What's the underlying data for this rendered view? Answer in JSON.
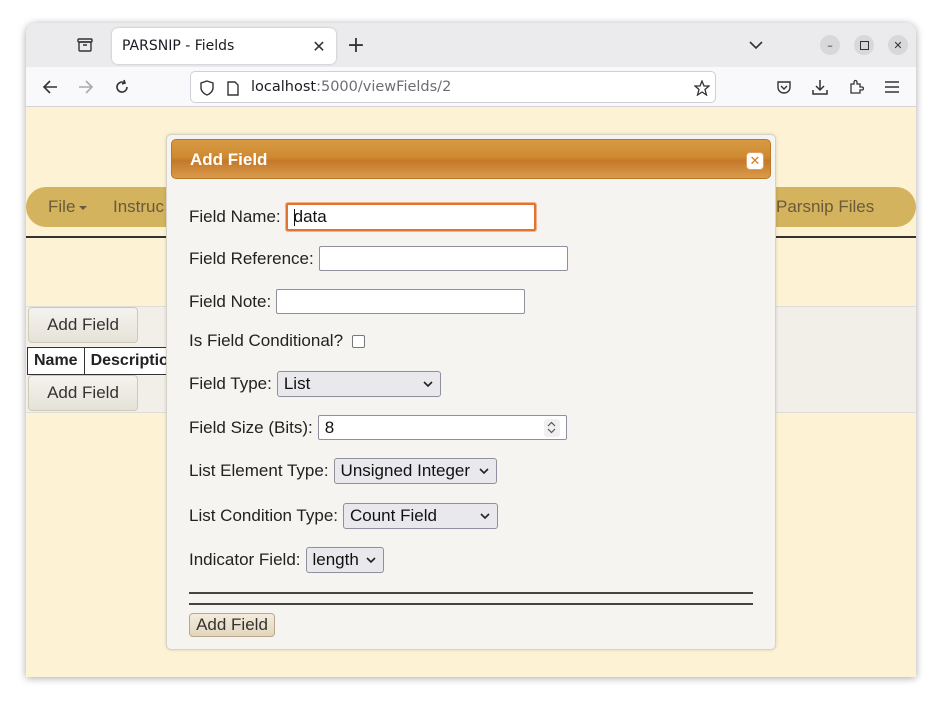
{
  "browser": {
    "tab_title": "PARSNIP - Fields",
    "url_host": "localhost",
    "url_path": ":5000/viewFields/2"
  },
  "page": {
    "menu": {
      "file_label": "File",
      "instructions_label": "Instruc",
      "parsnip_files_label": "Parsnip Files"
    },
    "background": {
      "add_field_top": "Add Field",
      "add_field_bottom": "Add Field",
      "table_headers": [
        "Name",
        "Descriptio"
      ]
    }
  },
  "dialog": {
    "title": "Add Field",
    "fields": {
      "field_name_label": "Field Name:",
      "field_name_value": "data",
      "field_reference_label": "Field Reference:",
      "field_reference_value": "",
      "field_note_label": "Field Note:",
      "field_note_value": "",
      "is_conditional_label": "Is Field Conditional?",
      "is_conditional_checked": false,
      "field_type_label": "Field Type:",
      "field_type_value": "List",
      "field_size_label": "Field Size (Bits):",
      "field_size_value": "8",
      "list_element_type_label": "List Element Type:",
      "list_element_type_value": "Unsigned Integer",
      "list_condition_type_label": "List Condition Type:",
      "list_condition_type_value": "Count Field",
      "indicator_field_label": "Indicator Field:",
      "indicator_field_value": "length"
    },
    "submit_label": "Add Field"
  },
  "colors": {
    "page_bg": "#fdf3d4",
    "menubar": "#d3b35e",
    "dialog_header": "#cf8a30",
    "focus_ring": "#e27335"
  }
}
